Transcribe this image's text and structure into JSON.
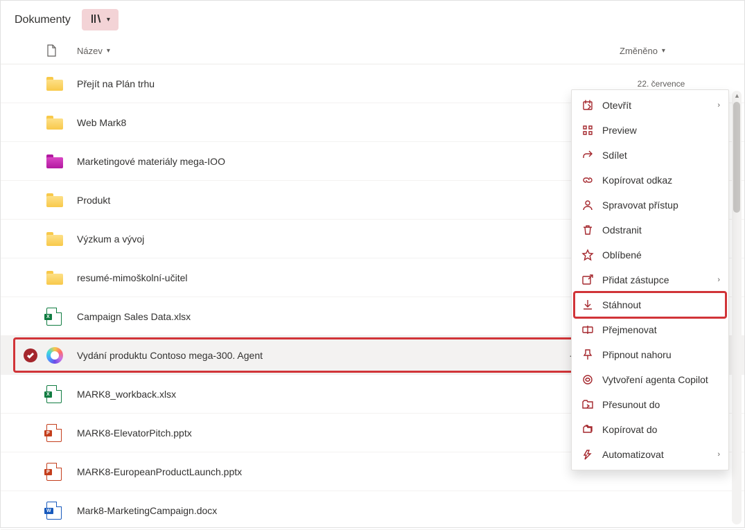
{
  "page": {
    "title": "Dokumenty"
  },
  "columns": {
    "name": "Název",
    "modified": "Změněno"
  },
  "rows": [
    {
      "type": "folder-yellow",
      "name": "Přejít na Plán trhu",
      "modified": "22. července"
    },
    {
      "type": "folder-yellow",
      "name": "Web Mark8",
      "modified": ""
    },
    {
      "type": "folder-magenta",
      "name": "Marketingové materiály mega-IOO",
      "modified": ""
    },
    {
      "type": "folder-yellow",
      "name": "Produkt",
      "modified": ""
    },
    {
      "type": "folder-yellow",
      "name": "Výzkum a vývoj",
      "modified": ""
    },
    {
      "type": "folder-yellow",
      "name": "resumé-mimoškolní-učitel",
      "modified": ""
    },
    {
      "type": "excel",
      "name": "Campaign Sales Data.xlsx",
      "modified": ""
    },
    {
      "type": "copilot",
      "name": "Vydání produktu Contoso mega-300. Agent",
      "modified": "",
      "selected": true
    },
    {
      "type": "excel",
      "name": "MARK8_workback.xlsx",
      "modified": ""
    },
    {
      "type": "ppt",
      "name": "MARK8-ElevatorPitch.pptx",
      "modified": ""
    },
    {
      "type": "ppt",
      "name": "MARK8-EuropeanProductLaunch.pptx",
      "modified": ""
    },
    {
      "type": "word",
      "name": "Mark8-MarketingCampaign.docx",
      "modified": ""
    }
  ],
  "menu": {
    "items": [
      {
        "icon": "open",
        "label": "Otevřít",
        "submenu": true
      },
      {
        "icon": "preview",
        "label": "Preview"
      },
      {
        "icon": "share",
        "label": "Sdílet"
      },
      {
        "icon": "link",
        "label": "Kopírovat odkaz"
      },
      {
        "icon": "access",
        "label": "Spravovat přístup"
      },
      {
        "icon": "delete",
        "label": "Odstranit"
      },
      {
        "icon": "favorite",
        "label": "Oblíbené"
      },
      {
        "icon": "shortcut",
        "label": "Přidat zástupce",
        "submenu": true
      },
      {
        "icon": "download",
        "label": "Stáhnout",
        "highlight": true
      },
      {
        "icon": "rename",
        "label": "Přejmenovat"
      },
      {
        "icon": "pin",
        "label": "Připnout nahoru"
      },
      {
        "icon": "copilot-agent",
        "label": "Vytvoření agenta Copilot"
      },
      {
        "icon": "moveto",
        "label": "Přesunout do"
      },
      {
        "icon": "copyto",
        "label": "Kopírovat do"
      },
      {
        "icon": "automate",
        "label": "Automatizovat",
        "submenu": true
      }
    ]
  },
  "colors": {
    "accent": "#a4262c",
    "highlight": "#d13438"
  }
}
